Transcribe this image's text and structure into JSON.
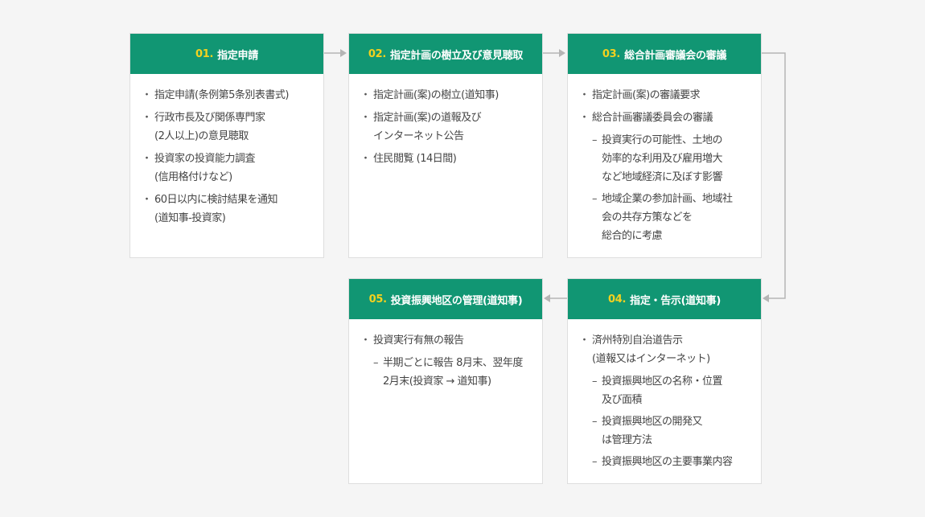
{
  "steps": [
    {
      "num": "01.",
      "title": "指定申請",
      "items": [
        {
          "text": "指定申請(条例第5条別表書式)",
          "subs": []
        },
        {
          "text": "行政市長及び関係専門家\n(2人以上)の意見聴取",
          "subs": []
        },
        {
          "text": "投資家の投資能力調査\n(信用格付けなど)",
          "subs": []
        },
        {
          "text": "60日以内に検討結果を通知\n(道知事-投資家)",
          "subs": []
        }
      ]
    },
    {
      "num": "02.",
      "title": "指定計画の樹立及び意見聴取",
      "items": [
        {
          "text": "指定計画(案)の樹立(道知事)",
          "subs": []
        },
        {
          "text": "指定計画(案)の道報及び\nインターネット公告",
          "subs": []
        },
        {
          "text": "住民閲覧 (14日間)",
          "subs": []
        }
      ]
    },
    {
      "num": "03.",
      "title": "総合計画審議会の審議",
      "items": [
        {
          "text": "指定計画(案)の審議要求",
          "subs": []
        },
        {
          "text": "総合計画審議委員会の審議",
          "subs": [
            "投資実行の可能性、土地の\n効率的な利用及び雇用増大\nなど地域経済に及ぼす影響",
            "地域企業の参加計画、地域社\n会の共存方策などを\n総合的に考慮"
          ]
        }
      ]
    },
    {
      "num": "04.",
      "title": "指定・告示(道知事)",
      "items": [
        {
          "text": "済州特別自治道告示\n(道報又はインターネット)",
          "subs": [
            "投資振興地区の名称・位置\n及び面積",
            "投資振興地区の開発又\nは管理方法",
            "投資振興地区の主要事業内容"
          ]
        }
      ]
    },
    {
      "num": "05.",
      "title": "投資振興地区の管理(道知事)",
      "items": [
        {
          "text": "投資実行有無の報告",
          "subs": [
            "半期ごとに報告 8月末、翌年度\n2月末(投資家 → 道知事)"
          ]
        }
      ]
    }
  ],
  "colors": {
    "header": "#119673",
    "number": "#f3d11f",
    "connector": "#b5b5b5",
    "background": "#f5f5f5"
  }
}
